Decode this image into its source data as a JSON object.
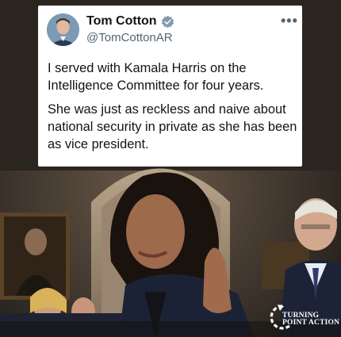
{
  "tweet": {
    "author_name": "Tom Cotton",
    "handle": "@TomCottonAR",
    "more_label": "•••",
    "paragraphs": [
      "I served with Kamala Harris on the Intelligence Committee for four years.",
      "She was just as reckless and naive about national security in private as she has been as vice president."
    ]
  },
  "brand": {
    "line1": "TURNING",
    "line2": "POINT ACTION"
  },
  "photo_credit": "",
  "colors": {
    "verified": "#829aab",
    "name_text": "#0f1419",
    "handle_text": "#536471",
    "suit_navy": "#1c2236"
  },
  "icons": [
    "verified-badge-icon",
    "more-options-icon",
    "turning-point-arrow-icon"
  ]
}
